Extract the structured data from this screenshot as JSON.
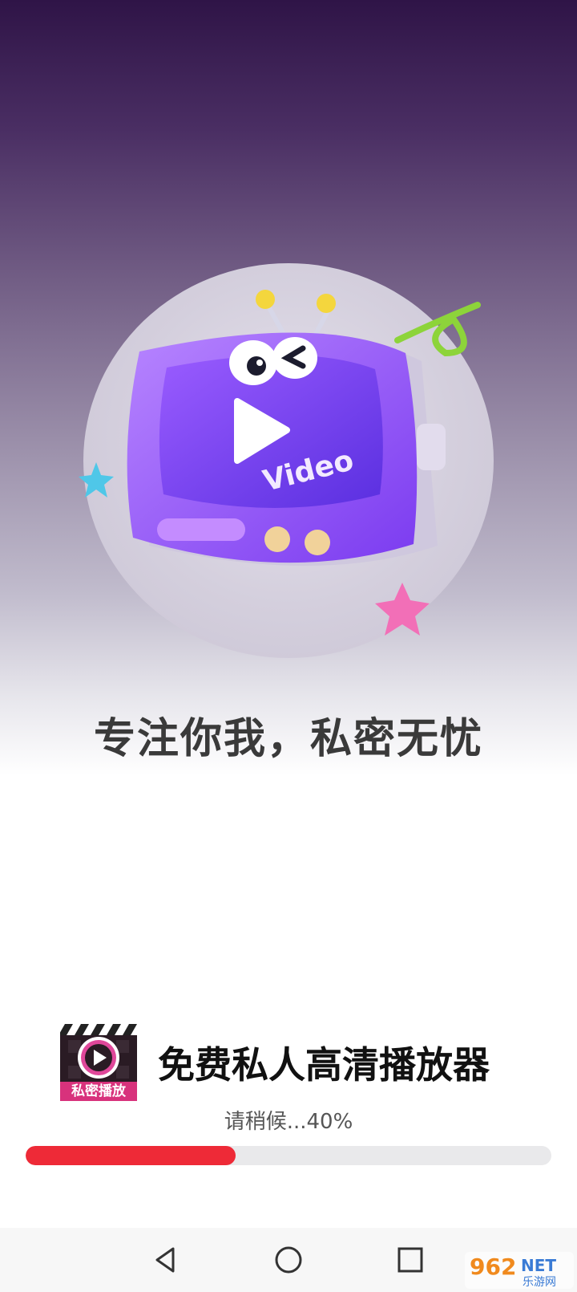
{
  "splash": {
    "slogan": "专注你我，私密无忧",
    "illustration_word": "Video"
  },
  "brand": {
    "logo_label": "私密播放",
    "app_name": "免费私人高清播放器"
  },
  "loading": {
    "text": "请稍候...40%",
    "progress": 0.4,
    "fill_color": "#ee2a37"
  },
  "nav": {
    "back_icon": "triangle-back-icon",
    "home_icon": "circle-home-icon",
    "recents_icon": "square-recents-icon"
  },
  "watermark": {
    "digits": "962",
    "suffix": "NET",
    "subtitle": "乐游网"
  },
  "colors": {
    "accent_purple": "#8a4dff",
    "progress_track": "#e9e9eb"
  }
}
